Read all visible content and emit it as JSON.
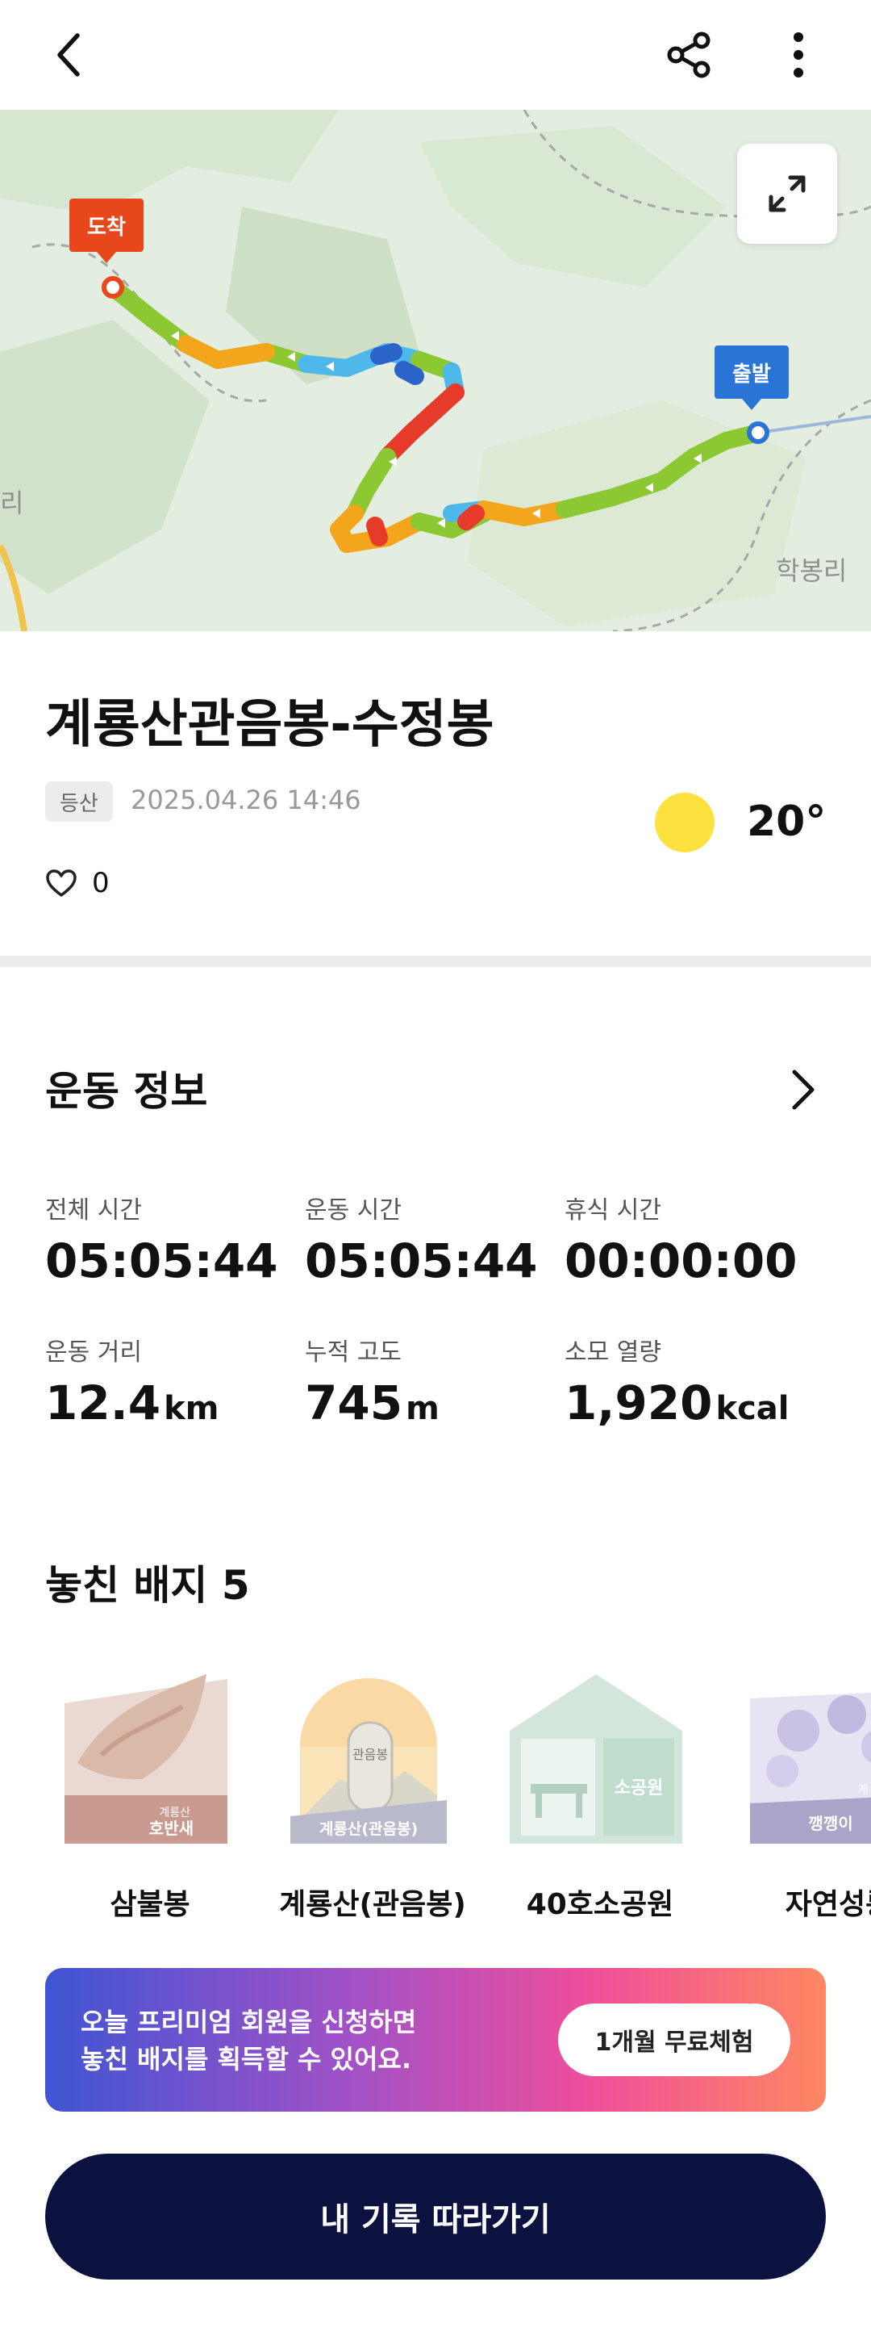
{
  "header": {
    "back_icon": "chevron-left-icon",
    "share_icon": "share-icon",
    "more_icon": "more-vertical-icon"
  },
  "map": {
    "arrive_label": "도착",
    "start_label": "출발",
    "place_labels": [
      "학봉리",
      "리"
    ],
    "expand_icon": "expand-icon",
    "route_colors": [
      "#8bc832",
      "#4fb8ea",
      "#f3a51b",
      "#e63a2b",
      "#2a64c8"
    ]
  },
  "activity": {
    "title": "계룡산관음봉-수정봉",
    "tag": "등산",
    "datetime": "2025.04.26 14:46",
    "weather_icon": "sun-icon",
    "temperature": "20°",
    "like_icon": "heart-outline-icon",
    "like_count": "0"
  },
  "exercise_info": {
    "section_title": "운동 정보",
    "stats": [
      {
        "label": "전체 시간",
        "value": "05:05:44",
        "unit": ""
      },
      {
        "label": "운동 시간",
        "value": "05:05:44",
        "unit": ""
      },
      {
        "label": "휴식 시간",
        "value": "00:00:00",
        "unit": ""
      },
      {
        "label": "운동 거리",
        "value": "12.4",
        "unit": "km"
      },
      {
        "label": "누적 고도",
        "value": "745",
        "unit": "m"
      },
      {
        "label": "소모 열량",
        "value": "1,920",
        "unit": "kcal"
      }
    ]
  },
  "missed_badges": {
    "section_title": "놓친 배지 5",
    "items": [
      {
        "name": "삼불봉",
        "art_main": "호반새",
        "art_sub": "계룡산"
      },
      {
        "name": "계룡산(관음봉)",
        "art_main": "계룡산(관음봉)",
        "art_sub": "관음봉"
      },
      {
        "name": "40호소공원",
        "art_main": "소공원",
        "art_sub": ""
      },
      {
        "name": "자연성릉",
        "art_main": "깽깽이",
        "art_sub": "계"
      }
    ]
  },
  "promo": {
    "line1": "오늘 프리미엄 회원을 신청하면",
    "line2": "놓친 배지를 획득할 수 있어요.",
    "button_label": "1개월 무료체험"
  },
  "follow_button_label": "내 기록 따라가기",
  "colors": {
    "primary_navy": "#0b1240",
    "arrive_flag": "#e8471c",
    "start_flag": "#2a74d6",
    "sun": "#fde23f"
  }
}
